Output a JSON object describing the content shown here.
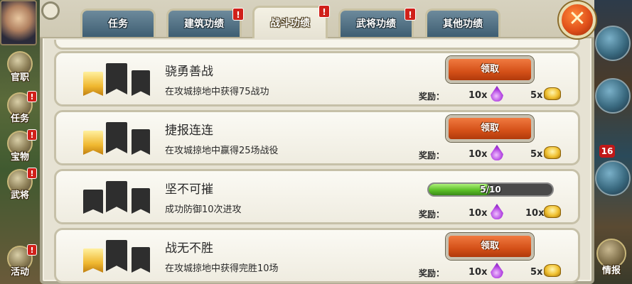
{
  "sidebar_left": {
    "items": [
      {
        "label": "官职",
        "alert": ""
      },
      {
        "label": "任务",
        "alert": "!"
      },
      {
        "label": "宝物",
        "alert": "!"
      },
      {
        "label": "武将",
        "alert": "!"
      },
      {
        "label": "活动",
        "alert": "!"
      }
    ]
  },
  "sidebar_right": {
    "badge": "16",
    "info_label": "情报"
  },
  "tabs": [
    {
      "label": "任务",
      "alert": "",
      "active": false
    },
    {
      "label": "建筑功绩",
      "alert": "!",
      "active": false
    },
    {
      "label": "战斗功绩",
      "alert": "!",
      "active": true
    },
    {
      "label": "武将功绩",
      "alert": "!",
      "active": false
    },
    {
      "label": "其他功绩",
      "alert": "",
      "active": false
    }
  ],
  "close_glyph": "✕",
  "reward_label": "奖励：",
  "claim_label": "领取",
  "achievements": [
    {
      "title": "骁勇善战",
      "desc": "在攻城掠地中获得75战功",
      "status": "claim",
      "gem": "10x",
      "gold": "5x"
    },
    {
      "title": "捷报连连",
      "desc": "在攻城掠地中赢得25场战役",
      "status": "claim",
      "gem": "10x",
      "gold": "5x"
    },
    {
      "title": "坚不可摧",
      "desc": "成功防御10次进攻",
      "status": "progress",
      "progress_text": "5/10",
      "progress_fraction": 0.5,
      "gem": "10x",
      "gold": "10x"
    },
    {
      "title": "战无不胜",
      "desc": "在攻城掠地中获得完胜10场",
      "status": "claim",
      "gem": "10x",
      "gold": "5x"
    }
  ],
  "colors": {
    "panel_bg": "#e6e2d3",
    "tab_inactive": "#3e5e72",
    "claim_button": "#d45018",
    "progress_fill": "#5cc028",
    "alert_red": "#d0201a"
  }
}
